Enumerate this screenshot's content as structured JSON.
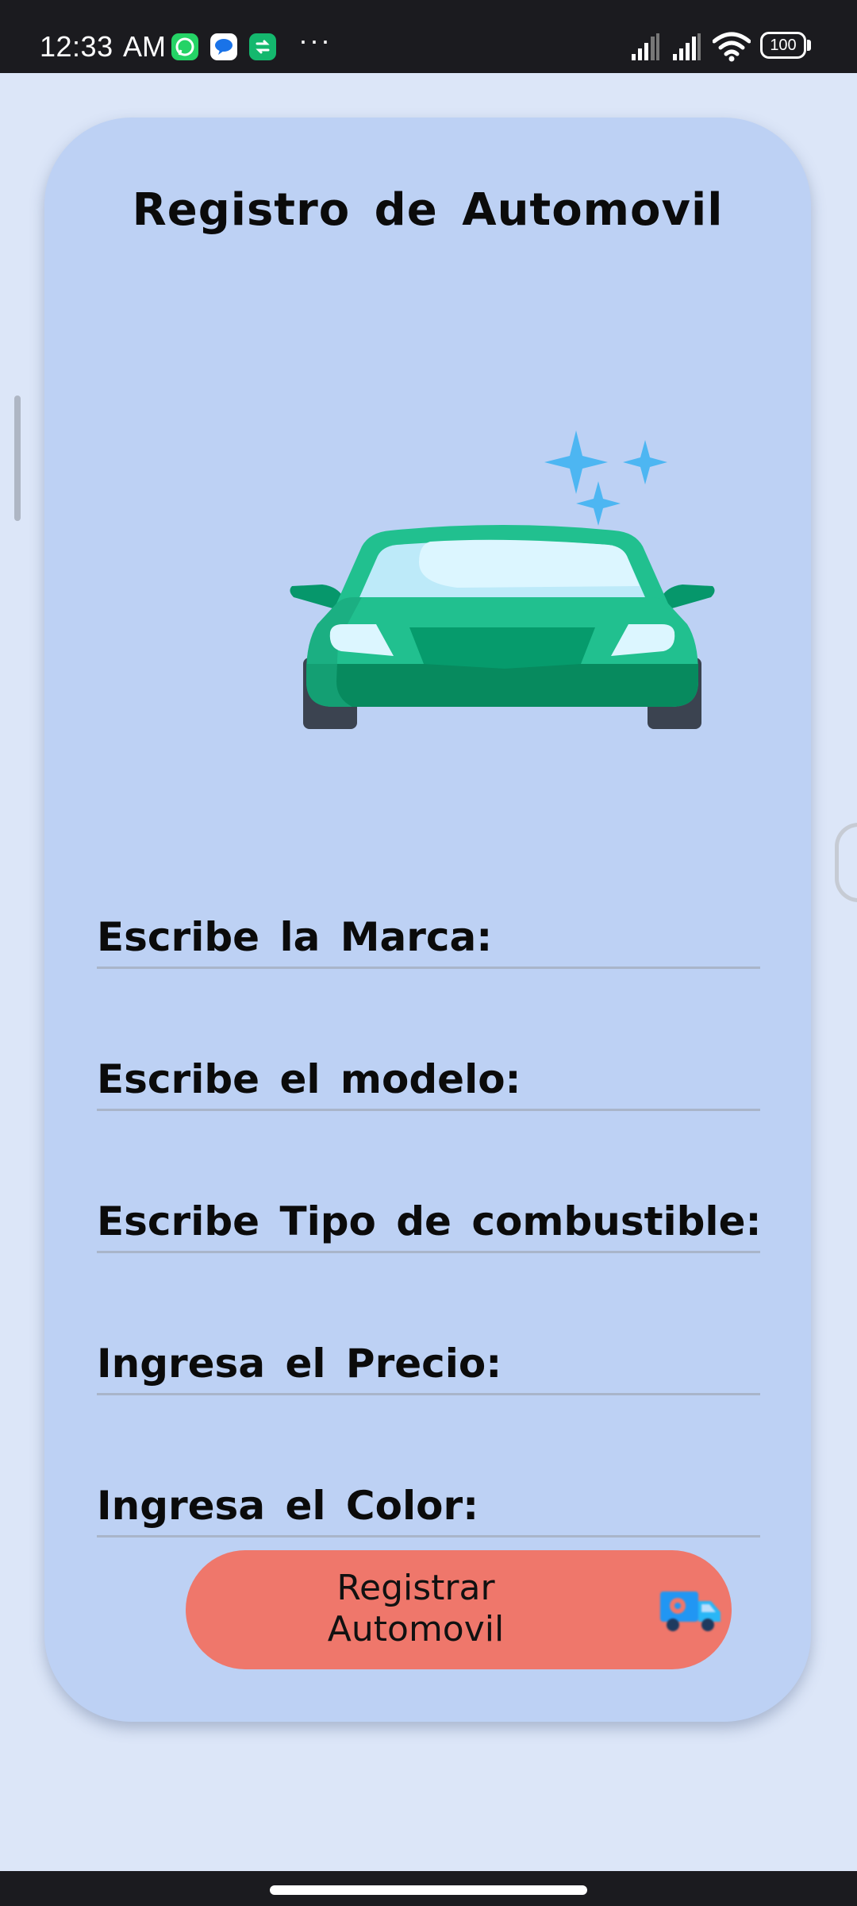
{
  "status_bar": {
    "time": "12:33",
    "ampm": "AM",
    "battery": "100",
    "more_indicator": "···",
    "icons": [
      "whatsapp-icon",
      "messages-icon",
      "app-icon",
      "signal-icon",
      "wifi-icon",
      "battery-icon"
    ]
  },
  "form": {
    "title": "Registro de Automovil",
    "fields": [
      {
        "label": "Escribe la Marca:"
      },
      {
        "label": "Escribe el modelo:"
      },
      {
        "label": "Escribe Tipo de combustible:"
      },
      {
        "label": "Ingresa el Precio:"
      },
      {
        "label": "Ingresa el Color:"
      }
    ],
    "submit_label": "Registrar\nAutomovil"
  },
  "colors": {
    "page_background": "#dce6f8",
    "card_background": "#bdd1f4",
    "button_background": "#ef776b",
    "car_body": "#21c08f",
    "sparkle": "#4db6f2"
  }
}
